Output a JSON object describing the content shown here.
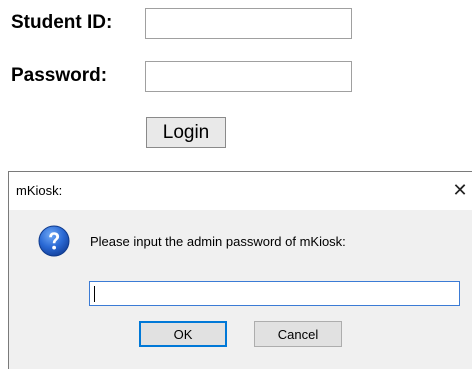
{
  "login_form": {
    "student_id_label": "Student ID:",
    "student_id_value": "",
    "password_label": "Password:",
    "password_value": "",
    "login_label": "Login"
  },
  "dialog": {
    "title": "mKiosk:",
    "close_glyph": "✕",
    "icon": "question-icon",
    "prompt": "Please input the admin password of mKiosk:",
    "input_value": "",
    "ok_label": "OK",
    "cancel_label": "Cancel"
  },
  "colors": {
    "focus_border": "#0078d7",
    "dialog_background": "#f0f0f0",
    "icon_blue": "#1c5cc8"
  }
}
